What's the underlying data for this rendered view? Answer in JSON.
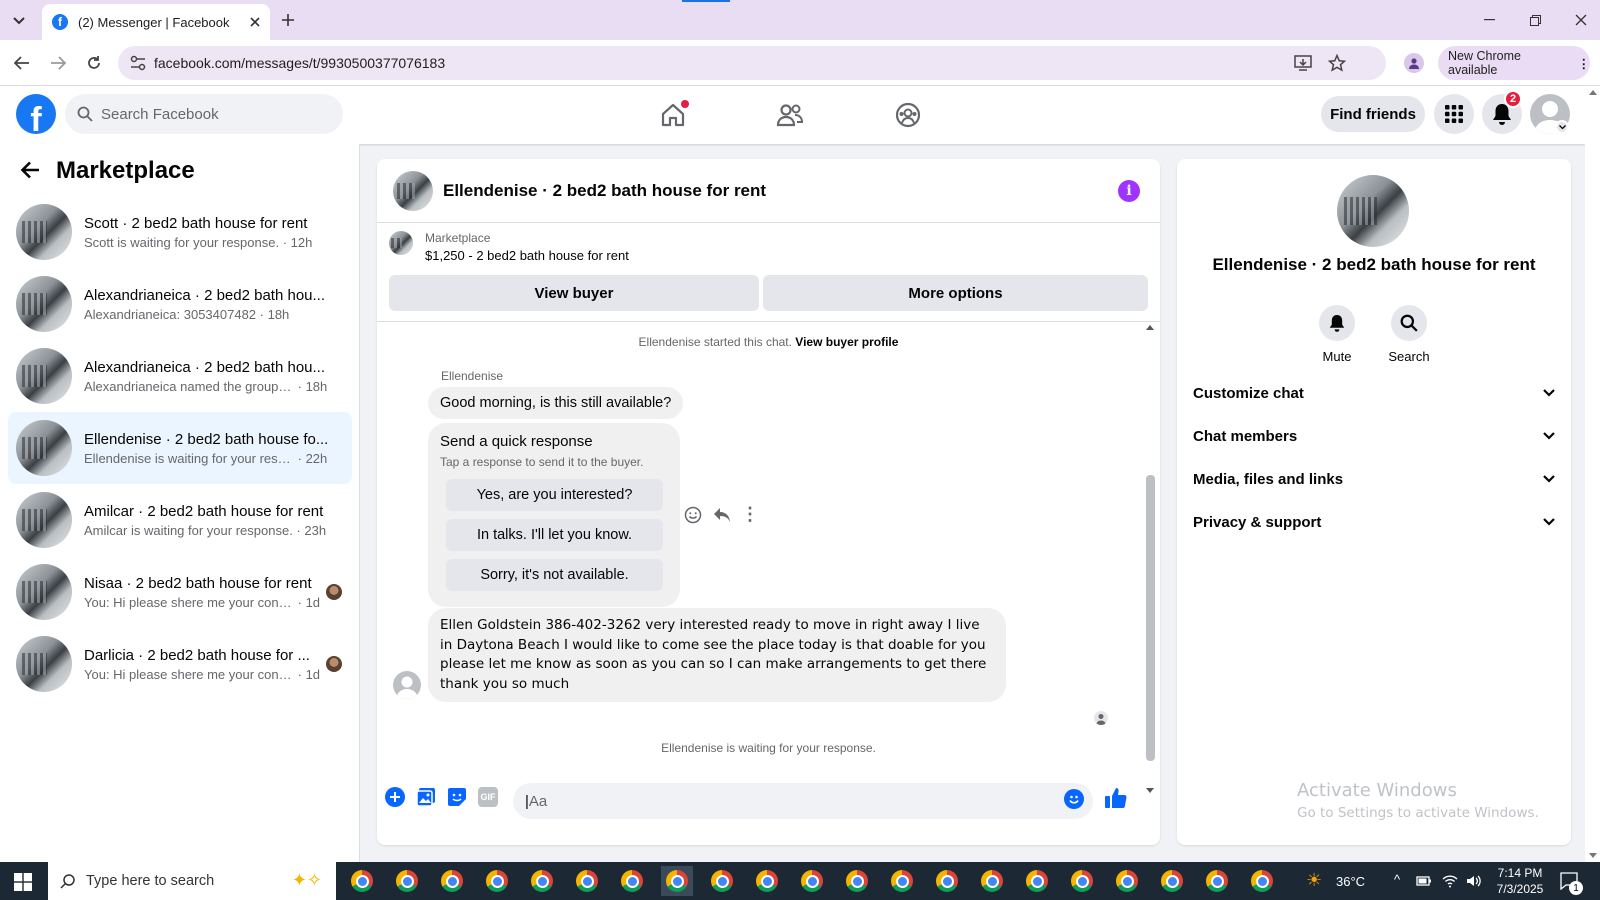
{
  "browser": {
    "tab_title": "(2) Messenger | Facebook",
    "url": "facebook.com/messages/t/9930500377076183",
    "new_chrome": "New Chrome available"
  },
  "fb": {
    "search_placeholder": "Search Facebook",
    "find_friends": "Find friends",
    "notif_count": "2"
  },
  "left": {
    "title": "Marketplace",
    "conversations": [
      {
        "name": "Scott · 2 bed2 bath house for rent",
        "preview": "Scott is waiting for your response.",
        "time": "12h"
      },
      {
        "name": "Alexandrianeica · 2 bed2 bath hou...",
        "preview": "Alexandrianeica: 3053407482",
        "time": "18h"
      },
      {
        "name": "Alexandrianeica · 2 bed2 bath hou...",
        "preview": "Alexandrianeica named the group Al...",
        "time": "18h"
      },
      {
        "name": "Ellendenise · 2 bed2 bath house fo...",
        "preview": "Ellendenise is waiting for your respo...",
        "time": "22h"
      },
      {
        "name": "Amilcar · 2 bed2 bath house for rent",
        "preview": "Amilcar is waiting for your response.",
        "time": "23h"
      },
      {
        "name": "Nisaa · 2 bed2 bath house for rent",
        "preview": "You: Hi please shere me your conta...",
        "time": "1d"
      },
      {
        "name": "Darlicia · 2 bed2 bath house for ...",
        "preview": "You: Hi please shere me your conta...",
        "time": "1d"
      }
    ]
  },
  "chat": {
    "title": "Ellendenise · 2 bed2 bath house for rent",
    "marketplace_label": "Marketplace",
    "listing": "$1,250 - 2 bed2 bath house for rent",
    "view_buyer": "View buyer",
    "more_options": "More options",
    "started": "Ellendenise started this chat.",
    "view_profile": "View buyer profile",
    "sender": "Ellendenise",
    "msg1": "Good morning, is this still available?",
    "quick_title": "Send a quick response",
    "quick_sub": "Tap a response to send it to the buyer.",
    "quick_replies": [
      "Yes, are you interested?",
      "In talks. I'll let you know.",
      "Sorry, it's not available."
    ],
    "msg2": "Ellen Goldstein 386-402-3262 very interested ready to move in right away I live in Daytona Beach I would like to come see the place today is that doable for you please let me know as soon as you can so I can make arrangements to get there thank you so much",
    "waiting": "Ellendenise is waiting for your response.",
    "input_placeholder": "Aa"
  },
  "info": {
    "name": "Ellendenise · 2 bed2 bath house for rent",
    "mute": "Mute",
    "search": "Search",
    "rows": [
      "Customize chat",
      "Chat members",
      "Media, files and links",
      "Privacy & support"
    ]
  },
  "watermark": {
    "line1": "Activate Windows",
    "line2": "Go to Settings to activate Windows."
  },
  "taskbar": {
    "search_placeholder": "Type here to search",
    "temp": "36°C",
    "time": "7:14 PM",
    "date": "7/3/2025",
    "notif_count": "1"
  }
}
